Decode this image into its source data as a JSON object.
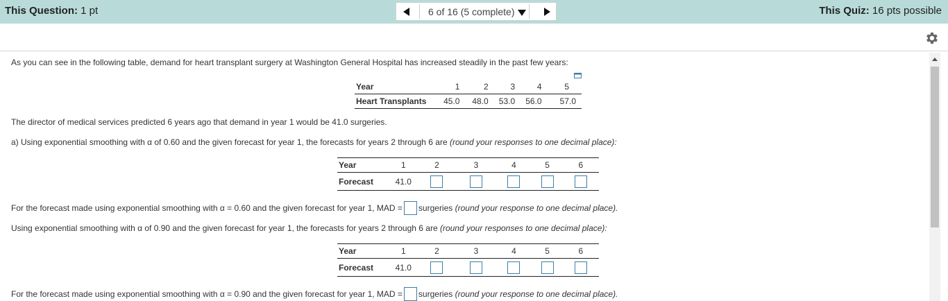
{
  "header": {
    "question_label": "This Question:",
    "question_value": "1 pt",
    "nav_selector": "6 of 16 (5 complete)",
    "quiz_label": "This Quiz:",
    "quiz_value": "16 pts possible"
  },
  "intro": "As you can see in the following table, demand for heart transplant surgery at Washington General Hospital has increased steadily in the past few years:",
  "demand_table": {
    "row1_label": "Year",
    "row1_values": [
      "1",
      "2",
      "3",
      "4",
      "5"
    ],
    "row2_label": "Heart Transplants",
    "row2_values": [
      "45.0",
      "48.0",
      "53.0",
      "56.0",
      "57.0"
    ]
  },
  "director_text": "The director of medical services predicted 6 years ago that demand in year 1 would be 41.0 surgeries.",
  "part_a": {
    "text": "a) Using exponential smoothing with α of 0.60 and the given forecast for year 1, the forecasts for years 2 through 6 are ",
    "hint": "(round your responses to one decimal place):",
    "table": {
      "row1_label": "Year",
      "years": [
        "1",
        "2",
        "3",
        "4",
        "5",
        "6"
      ],
      "row2_label": "Forecast",
      "first_value": "41.0"
    },
    "mad_text": "For the forecast made using exponential smoothing with α = 0.60 and the given forecast for year 1, MAD =",
    "mad_unit": "surgeries",
    "mad_hint": "(round your response to one decimal place)."
  },
  "part_b": {
    "text": "Using exponential smoothing with α of 0.90 and the given forecast for year 1, the forecasts for years 2 through 6 are ",
    "hint": "(round your responses to one decimal place):",
    "table": {
      "row1_label": "Year",
      "years": [
        "1",
        "2",
        "3",
        "4",
        "5",
        "6"
      ],
      "row2_label": "Forecast",
      "first_value": "41.0"
    },
    "mad_text": "For the forecast made using exponential smoothing with α = 0.90 and the given forecast for year 1, MAD =",
    "mad_unit": "surgeries",
    "mad_hint": "(round your response to one decimal place)."
  },
  "icons": {
    "settings": "gear-icon",
    "prev": "triangle-left-icon",
    "next": "triangle-right-icon",
    "dropdown": "caret-down-icon",
    "expand": "expand-table-icon"
  },
  "colors": {
    "header_bg": "#b8dbd9",
    "input_border": "#3a7fa6"
  }
}
